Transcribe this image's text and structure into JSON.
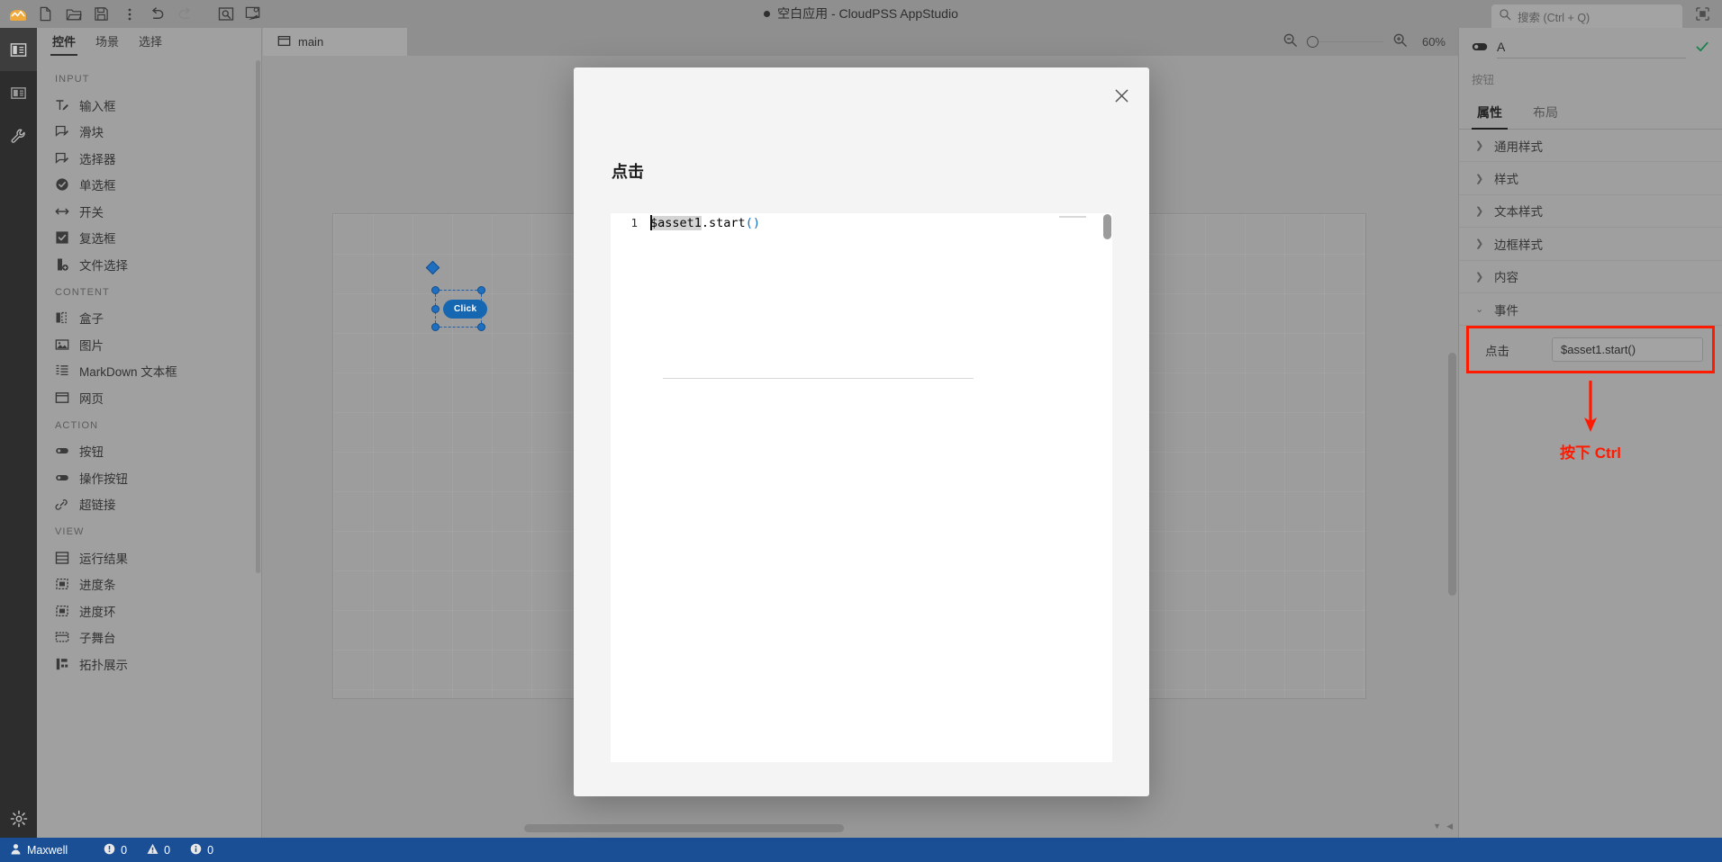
{
  "window": {
    "title": "空白应用 - CloudPSS AppStudio",
    "modified_dot": "●"
  },
  "toolbar": {
    "items": [
      {
        "name": "app-logo-icon",
        "label": "CloudPSS"
      },
      {
        "name": "new-file-icon",
        "label": "新建"
      },
      {
        "name": "open-folder-icon",
        "label": "打开"
      },
      {
        "name": "save-icon",
        "label": "保存"
      },
      {
        "name": "more-options-icon",
        "label": "更多"
      },
      {
        "name": "undo-icon",
        "label": "撤销"
      },
      {
        "name": "redo-icon",
        "label": "重做"
      },
      {
        "name": "preview-icon",
        "label": "预览"
      },
      {
        "name": "run-icon",
        "label": "运行"
      }
    ]
  },
  "search": {
    "placeholder": "搜索 (Ctrl + Q)",
    "icon": "search-icon"
  },
  "window_controls": {
    "maximize_icon": "maximize-icon"
  },
  "left_panel": {
    "tabs": [
      {
        "label": "控件",
        "active": true
      },
      {
        "label": "场景",
        "active": false
      },
      {
        "label": "选择",
        "active": false
      }
    ],
    "groups": [
      {
        "title": "INPUT",
        "items": [
          {
            "label": "输入框",
            "icon": "text-input-icon"
          },
          {
            "label": "滑块",
            "icon": "slider-icon"
          },
          {
            "label": "选择器",
            "icon": "selector-icon"
          },
          {
            "label": "单选框",
            "icon": "radio-icon"
          },
          {
            "label": "开关",
            "icon": "switch-icon"
          },
          {
            "label": "复选框",
            "icon": "checkbox-icon"
          },
          {
            "label": "文件选择",
            "icon": "file-picker-icon"
          }
        ]
      },
      {
        "title": "CONTENT",
        "items": [
          {
            "label": "盒子",
            "icon": "box-icon"
          },
          {
            "label": "图片",
            "icon": "image-icon"
          },
          {
            "label": "MarkDown 文本框",
            "icon": "markdown-icon"
          },
          {
            "label": "网页",
            "icon": "webpage-icon"
          }
        ]
      },
      {
        "title": "ACTION",
        "items": [
          {
            "label": "按钮",
            "icon": "button-icon"
          },
          {
            "label": "操作按钮",
            "icon": "action-button-icon"
          },
          {
            "label": "超链接",
            "icon": "link-icon"
          }
        ]
      },
      {
        "title": "VIEW",
        "items": [
          {
            "label": "运行结果",
            "icon": "result-icon"
          },
          {
            "label": "进度条",
            "icon": "progress-bar-icon"
          },
          {
            "label": "进度环",
            "icon": "progress-ring-icon"
          },
          {
            "label": "子舞台",
            "icon": "substage-icon"
          },
          {
            "label": "拓扑展示",
            "icon": "topology-icon"
          }
        ]
      }
    ]
  },
  "editor": {
    "tab": {
      "label": "main",
      "icon": "window-icon"
    },
    "zoom": {
      "zoom_out_icon": "zoom-out-icon",
      "zoom_in_icon": "zoom-in-icon",
      "percent": "60%"
    },
    "stage": {
      "button_label": "Click"
    }
  },
  "right_panel": {
    "component_name": "A",
    "component_type": "按钮",
    "confirm_icon": "check-icon",
    "toggle_icon": "switch-icon",
    "tabs": [
      {
        "label": "属性",
        "active": true
      },
      {
        "label": "布局",
        "active": false
      }
    ],
    "sections": [
      {
        "label": "通用样式",
        "expanded": false
      },
      {
        "label": "样式",
        "expanded": false
      },
      {
        "label": "文本样式",
        "expanded": false
      },
      {
        "label": "边框样式",
        "expanded": false
      },
      {
        "label": "内容",
        "expanded": false
      },
      {
        "label": "事件",
        "expanded": true
      }
    ],
    "event": {
      "label": "点击",
      "value": "$asset1.start()"
    },
    "annotation": {
      "text": "按下 Ctrl",
      "color": "#ff1a00"
    },
    "highlight_color": "#ff1a00"
  },
  "modal": {
    "title": "点击",
    "close_icon": "close-icon",
    "code": {
      "line_number": "1",
      "selected_text": "$asset1",
      "rest_text": ".start",
      "paren_text": "()"
    }
  },
  "statusbar": {
    "user": "Maxwell",
    "user_icon": "user-icon",
    "error_icon": "error-icon",
    "error_count": "0",
    "warning_icon": "warning-icon",
    "warning_count": "0",
    "info_icon": "info-icon",
    "info_count": "0",
    "background": "#1a4f96"
  }
}
